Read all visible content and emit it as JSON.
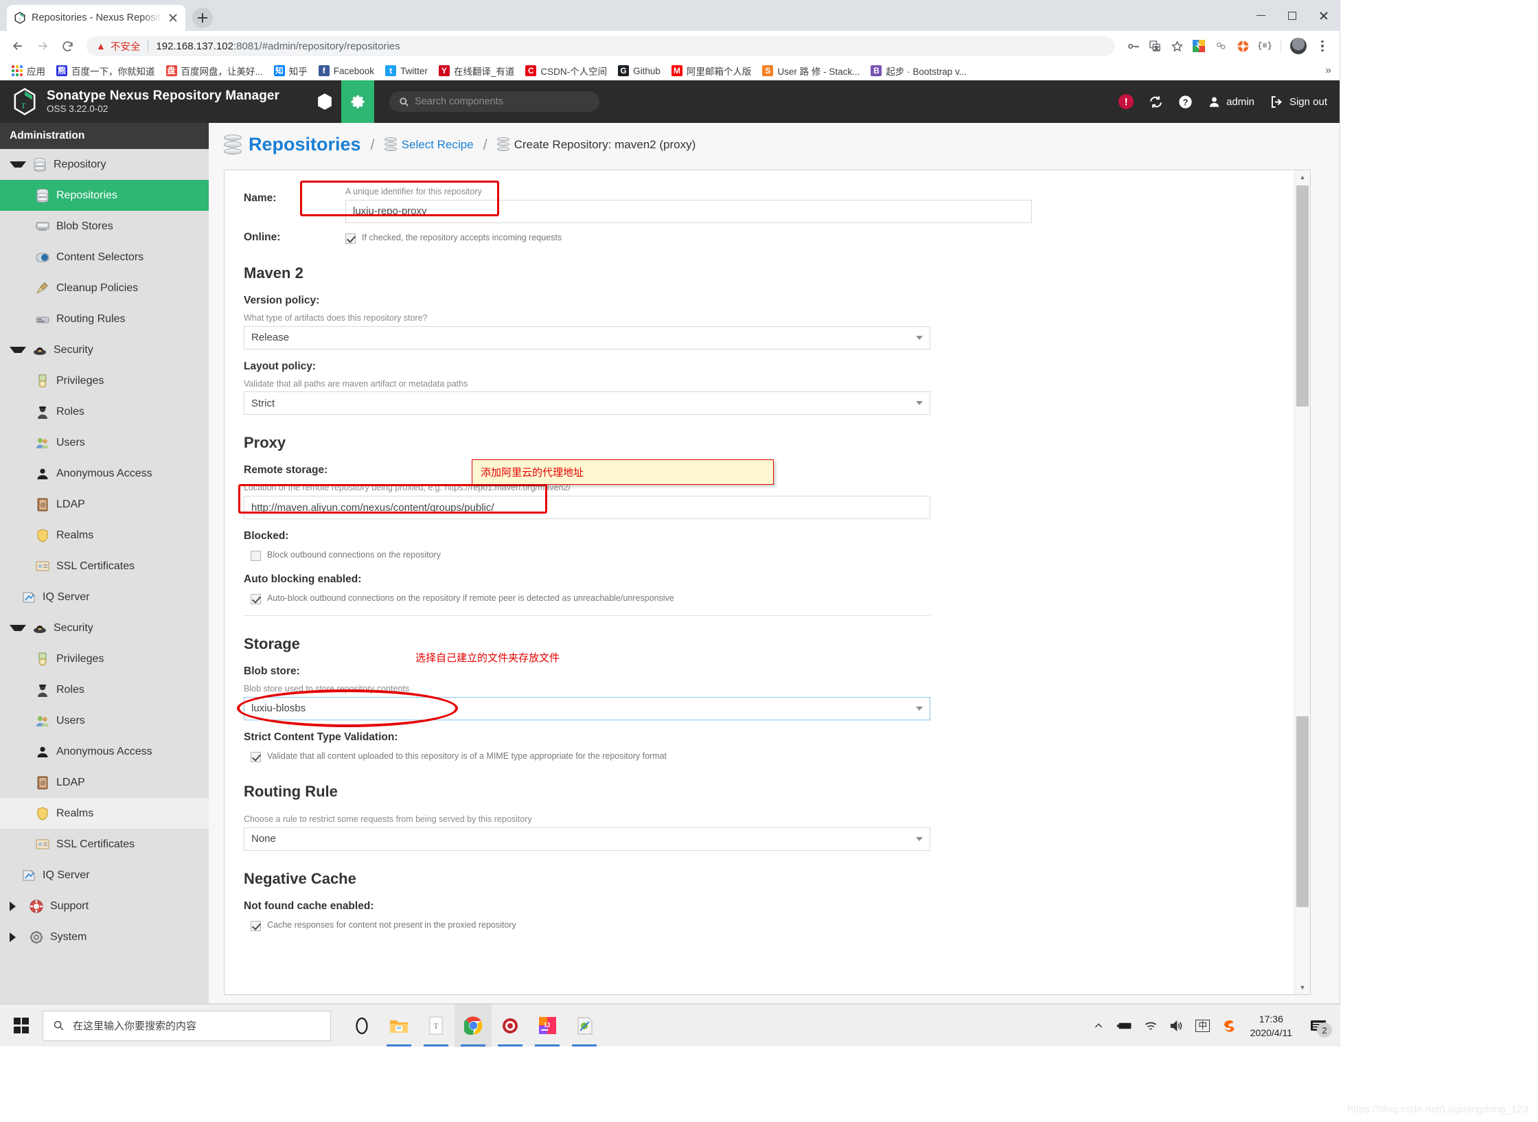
{
  "browser": {
    "tab": {
      "title": "Repositories - Nexus Reposito",
      "favicon_name": "nexus-favicon"
    },
    "newtab_label": "+",
    "omnibox": {
      "security_label": "不安全",
      "url_host": "192.168.137.102",
      "url_rest": ":8081/#admin/repository/repositories"
    },
    "bookmarks": [
      {
        "label": "应用",
        "icon": "apps-grid-icon",
        "color": "#4285f4"
      },
      {
        "label": "百度一下，你就知道",
        "icon": "baidu-icon",
        "color": "#2932e1",
        "glyph": "熊"
      },
      {
        "label": "百度网盘，让美好...",
        "icon": "baidu-pan-icon",
        "color": "#e8453c",
        "glyph": "盘"
      },
      {
        "label": "知乎",
        "icon": "zhihu-icon",
        "color": "#0084ff",
        "glyph": "知"
      },
      {
        "label": "Facebook",
        "icon": "facebook-icon",
        "color": "#3b5998",
        "glyph": "f"
      },
      {
        "label": "Twitter",
        "icon": "twitter-icon",
        "color": "#1da1f2",
        "glyph": "t"
      },
      {
        "label": "在线翻译_有道",
        "icon": "youdao-icon",
        "color": "#d0021b",
        "glyph": "Y"
      },
      {
        "label": "CSDN-个人空间",
        "icon": "csdn-icon",
        "color": "#e60012",
        "glyph": "C"
      },
      {
        "label": "Github",
        "icon": "github-icon",
        "color": "#1b1f23",
        "glyph": "G"
      },
      {
        "label": "阿里邮箱个人版",
        "icon": "aliyun-mail-icon",
        "color": "#ff0000",
        "glyph": "M"
      },
      {
        "label": "User 路 修 - Stack...",
        "icon": "stackoverflow-icon",
        "color": "#f48024",
        "glyph": "S"
      },
      {
        "label": "起步 · Bootstrap v...",
        "icon": "bootstrap-icon",
        "color": "#7952b3",
        "glyph": "B"
      }
    ],
    "bookmarks_overflow": "»"
  },
  "nexus": {
    "brand_line1": "Sonatype Nexus Repository Manager",
    "brand_line2": "OSS 3.22.0-02",
    "search_placeholder": "Search components",
    "user_name": "admin",
    "sign_out_label": "Sign out",
    "accent_green": "#2eb673",
    "header_bg": "#2b2b2b",
    "sidebar": {
      "title": "Administration",
      "groups": [
        {
          "label": "Repository",
          "icon": "database-icon",
          "expanded": true,
          "items": [
            {
              "label": "Repositories",
              "icon": "database-icon",
              "selected": true
            },
            {
              "label": "Blob Stores",
              "icon": "blob-store-icon"
            },
            {
              "label": "Content Selectors",
              "icon": "content-selector-icon"
            },
            {
              "label": "Cleanup Policies",
              "icon": "broom-icon"
            },
            {
              "label": "Routing Rules",
              "icon": "routing-rule-icon"
            }
          ]
        },
        {
          "label": "Security",
          "icon": "security-icon",
          "expanded": true,
          "items": [
            {
              "label": "Privileges",
              "icon": "privilege-icon"
            },
            {
              "label": "Roles",
              "icon": "role-icon"
            },
            {
              "label": "Users",
              "icon": "users-icon"
            },
            {
              "label": "Anonymous Access",
              "icon": "anonymous-icon"
            },
            {
              "label": "LDAP",
              "icon": "ldap-icon"
            },
            {
              "label": "Realms",
              "icon": "shield-icon"
            },
            {
              "label": "SSL Certificates",
              "icon": "certificate-icon"
            },
            {
              "label": "IQ Server",
              "icon": "iq-server-icon",
              "outdent": true
            }
          ]
        },
        {
          "label": "Security",
          "icon": "security-icon",
          "expanded": true,
          "items": [
            {
              "label": "Privileges",
              "icon": "privilege-icon"
            },
            {
              "label": "Roles",
              "icon": "role-icon"
            },
            {
              "label": "Users",
              "icon": "users-icon"
            },
            {
              "label": "Anonymous Access",
              "icon": "anonymous-icon"
            },
            {
              "label": "LDAP",
              "icon": "ldap-icon"
            },
            {
              "label": "Realms",
              "icon": "shield-icon",
              "hover": true
            },
            {
              "label": "SSL Certificates",
              "icon": "certificate-icon"
            },
            {
              "label": "IQ Server",
              "icon": "iq-server-icon",
              "outdent": true
            }
          ]
        },
        {
          "label": "Support",
          "icon": "lifebuoy-icon",
          "expanded": false,
          "items": []
        },
        {
          "label": "System",
          "icon": "gear-icon",
          "expanded": false,
          "items": []
        }
      ]
    },
    "breadcrumb": {
      "root": "Repositories",
      "sep": "/",
      "link": "Select Recipe",
      "current": "Create Repository: maven2 (proxy)"
    },
    "form": {
      "name_label": "Name:",
      "name_hint": "A unique identifier for this repository",
      "name_value": "luxiu-repo-proxy",
      "online_label": "Online:",
      "online_hint": "If checked, the repository accepts incoming requests",
      "online_checked": true,
      "maven_section": "Maven 2",
      "version_policy_label": "Version policy:",
      "version_policy_hint": "What type of artifacts does this repository store?",
      "version_policy_value": "Release",
      "layout_policy_label": "Layout policy:",
      "layout_policy_hint": "Validate that all paths are maven artifact or metadata paths",
      "layout_policy_value": "Strict",
      "proxy_section": "Proxy",
      "remote_storage_label": "Remote storage:",
      "remote_storage_hint": "Location of the remote repository being proxied, e.g. https://repo1.maven.org/maven2/",
      "remote_storage_value": "http://maven.aliyun.com/nexus/content/groups/public/",
      "blocked_label": "Blocked:",
      "blocked_hint": "Block outbound connections on the repository",
      "blocked_checked": false,
      "auto_blocking_label": "Auto blocking enabled:",
      "auto_blocking_hint": "Auto-block outbound connections on the repository if remote peer is detected as unreachable/unresponsive",
      "auto_blocking_checked": true,
      "storage_section": "Storage",
      "blob_store_label": "Blob store:",
      "blob_store_hint": "Blob store used to store repository contents",
      "blob_store_value": "luxiu-blosbs",
      "strict_content_label": "Strict Content Type Validation:",
      "strict_content_hint": "Validate that all content uploaded to this repository is of a MIME type appropriate for the repository format",
      "strict_content_checked": true,
      "routing_section": "Routing Rule",
      "routing_hint": "Choose a rule to restrict some requests from being served by this repository",
      "routing_value": "None",
      "negative_cache_section": "Negative Cache",
      "not_found_label": "Not found cache enabled:",
      "not_found_hint": "Cache responses for content not present in the proxied repository",
      "not_found_checked": true
    },
    "annotations": {
      "remote_note": "添加阿里云的代理地址",
      "blob_note": "选择自己建立的文件夹存放文件"
    }
  },
  "taskbar": {
    "search_placeholder": "在这里输入你要搜索的内容",
    "apps": [
      {
        "name": "cortana-icon"
      },
      {
        "name": "file-explorer-icon"
      },
      {
        "name": "typora-icon"
      },
      {
        "name": "chrome-icon"
      },
      {
        "name": "navicat-icon"
      },
      {
        "name": "intellij-idea-icon"
      },
      {
        "name": "xshell-icon"
      }
    ],
    "tray": {
      "chevron": "︿",
      "battery": "battery-icon",
      "wifi": "wifi-icon",
      "volume": "volume-icon",
      "ime": "中",
      "sogou": "S"
    },
    "time": "17:36",
    "date": "2020/4/11",
    "notification_count": "2"
  },
  "watermark": "https://blog.csdn.net/Luguangdong_123"
}
